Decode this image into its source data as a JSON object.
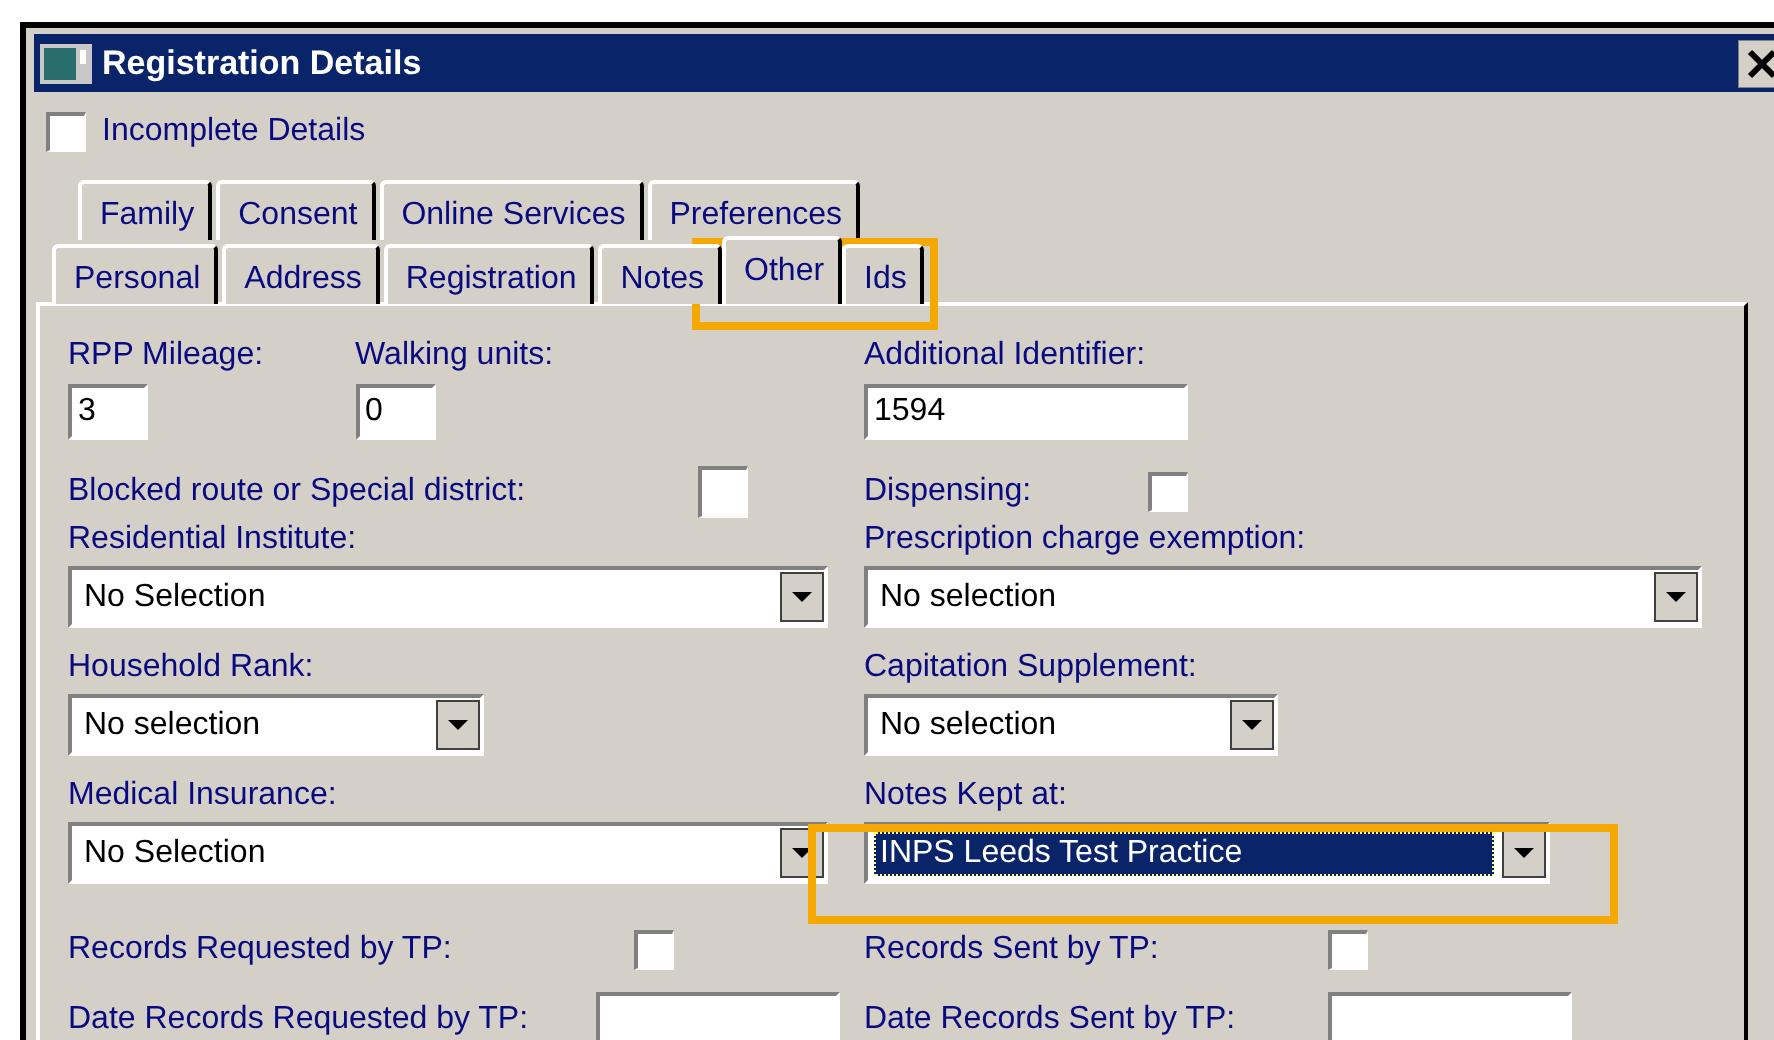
{
  "window": {
    "title": "Registration Details"
  },
  "incomplete_details": {
    "label": "Incomplete Details",
    "checked": false
  },
  "tab_rows": [
    [
      {
        "label": "Family",
        "selected": false
      },
      {
        "label": "Consent",
        "selected": false
      },
      {
        "label": "Online Services",
        "selected": false
      },
      {
        "label": "Preferences",
        "selected": false
      }
    ],
    [
      {
        "label": "Personal",
        "selected": false
      },
      {
        "label": "Address",
        "selected": false
      },
      {
        "label": "Registration",
        "selected": false
      },
      {
        "label": "Notes",
        "selected": false
      },
      {
        "label": "Other",
        "selected": true
      },
      {
        "label": "Ids",
        "selected": false
      }
    ]
  ],
  "form_rows": [
    {
      "left": [
        {
          "kind": "text",
          "label": "RPP Mileage:",
          "value": "3"
        },
        {
          "kind": "text",
          "label": "Walking units:",
          "value": "0"
        }
      ],
      "right": [
        {
          "kind": "text",
          "label": "Additional Identifier:",
          "value": "1594"
        }
      ]
    },
    {
      "left": [
        {
          "kind": "checkbox",
          "label": "Blocked route or Special district:",
          "checked": false
        }
      ],
      "right": [
        {
          "kind": "checkbox",
          "label": "Dispensing:",
          "checked": false
        }
      ]
    },
    {
      "left": [
        {
          "kind": "dropdown",
          "label": "Residential Institute:",
          "value": "No Selection",
          "focused": false
        }
      ],
      "right": [
        {
          "kind": "dropdown",
          "label": "Prescription charge exemption:",
          "value": "No selection",
          "focused": false
        }
      ]
    },
    {
      "left": [
        {
          "kind": "dropdown",
          "label": "Household Rank:",
          "value": "No selection",
          "focused": false
        }
      ],
      "right": [
        {
          "kind": "dropdown",
          "label": "Capitation Supplement:",
          "value": "No selection",
          "focused": false
        }
      ]
    },
    {
      "left": [
        {
          "kind": "dropdown",
          "label": "Medical Insurance:",
          "value": "No Selection",
          "focused": false
        }
      ],
      "right": [
        {
          "kind": "dropdown",
          "label": "Notes Kept at:",
          "value": "INPS Leeds Test Practice",
          "focused": true
        }
      ]
    },
    {
      "left": [
        {
          "kind": "checkbox",
          "label": "Records Requested by TP:",
          "checked": false
        }
      ],
      "right": [
        {
          "kind": "checkbox",
          "label": "Records Sent by TP:",
          "checked": false
        }
      ]
    },
    {
      "left": [
        {
          "kind": "date",
          "label": "Date Records Requested by TP:"
        }
      ],
      "right": [
        {
          "kind": "date",
          "label": "Date Records Sent by TP:"
        }
      ]
    }
  ]
}
